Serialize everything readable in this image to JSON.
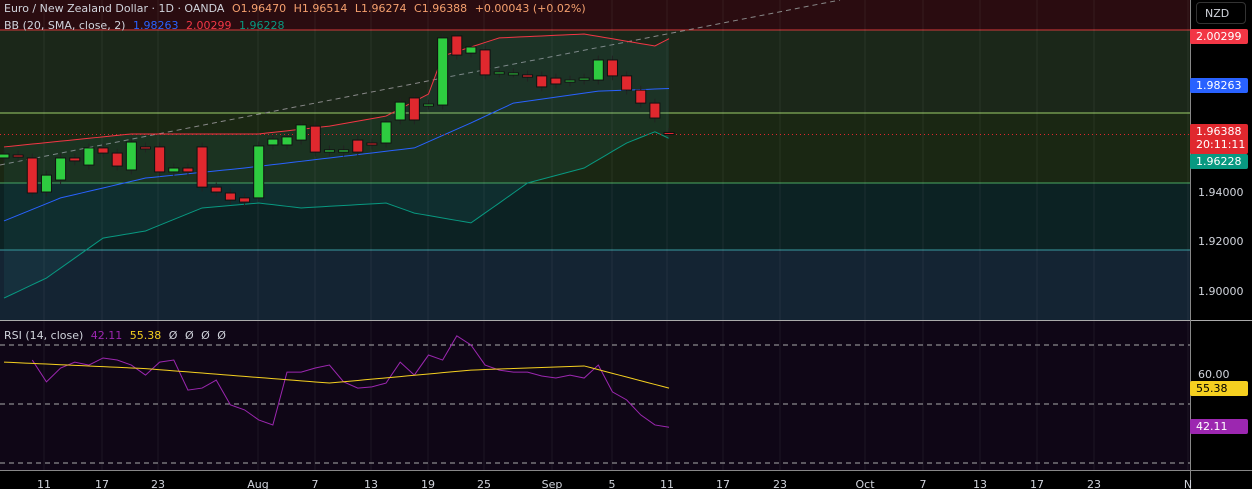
{
  "header": {
    "symbol": "Euro / New Zealand Dollar · 1D · OANDA",
    "open": "O1.96470",
    "high": "H1.96514",
    "low": "L1.96274",
    "close": "C1.96388",
    "change": "+0.00043 (+0.02%)"
  },
  "bb_legend": {
    "label": "BB (20, SMA, close, 2)",
    "basis": "1.98263",
    "upper": "2.00299",
    "lower": "1.96228"
  },
  "rsi_legend": {
    "label": "RSI (14, close)",
    "rsi": "42.11",
    "ma": "55.38",
    "extra": [
      "Ø",
      "Ø",
      "Ø",
      "Ø"
    ]
  },
  "price_axis": {
    "currency": "NZD",
    "ticks": [
      "1.94000",
      "1.92000",
      "1.90000"
    ],
    "upper_tag": "2.00299",
    "basis_tag": "1.98263",
    "last_tag": "1.96388",
    "countdown": "20:11:11",
    "lower_tag": "1.96228"
  },
  "rsi_axis": {
    "ticks": [
      "60.00"
    ],
    "ma_tag": "55.38",
    "rsi_tag": "42.11"
  },
  "time_axis": [
    "11",
    "17",
    "23",
    "Aug",
    "7",
    "13",
    "19",
    "25",
    "Sep",
    "5",
    "11",
    "17",
    "23",
    "Oct",
    "7",
    "13",
    "17",
    "23",
    "N"
  ],
  "colors": {
    "up": "#2ecc40",
    "down": "#e0282e",
    "bb_upper": "#f23645",
    "bb_basis": "#2962ff",
    "bb_lower": "#089981",
    "rsi": "#9c27b0",
    "rsi_ma": "#f5d020"
  },
  "chart_data": {
    "type": "candlestick",
    "candles": [
      [
        1.9543,
        1.9559
      ],
      [
        1.9555,
        1.9547
      ],
      [
        1.9543,
        1.94
      ],
      [
        1.9404,
        1.9473
      ],
      [
        1.9453,
        1.9543
      ],
      [
        1.9543,
        1.9531
      ],
      [
        1.9514,
        1.9584
      ],
      [
        1.9584,
        1.9563
      ],
      [
        1.9563,
        1.951
      ],
      [
        1.9494,
        1.9608
      ],
      [
        1.9588,
        1.9584
      ],
      [
        1.9588,
        1.9486
      ],
      [
        1.9486,
        1.9502
      ],
      [
        1.9502,
        1.9486
      ],
      [
        1.9588,
        1.9424
      ],
      [
        1.9424,
        1.9404
      ],
      [
        1.94,
        1.9371
      ],
      [
        1.938,
        1.9363
      ],
      [
        1.938,
        1.9592
      ],
      [
        1.9596,
        1.962
      ],
      [
        1.9596,
        1.9629
      ],
      [
        1.9616,
        1.9678
      ],
      [
        1.9673,
        1.9567
      ],
      [
        1.9567,
        1.9576
      ],
      [
        1.9567,
        1.9576
      ],
      [
        1.9616,
        1.9567
      ],
      [
        1.9604,
        1.9596
      ],
      [
        1.9604,
        1.969
      ],
      [
        1.9698,
        1.9771
      ],
      [
        1.9788,
        1.9698
      ],
      [
        1.9759,
        1.9763
      ],
      [
        1.9759,
        2.0033
      ],
      [
        2.0041,
        1.9963
      ],
      [
        1.9971,
        1.9996
      ],
      [
        1.9984,
        1.9882
      ],
      [
        1.989,
        1.9894
      ],
      [
        1.989,
        1.989
      ],
      [
        1.9882,
        1.9873
      ],
      [
        1.9878,
        1.9833
      ],
      [
        1.9869,
        1.9845
      ],
      [
        1.9853,
        1.9861
      ],
      [
        1.9861,
        1.9869
      ],
      [
        1.9861,
        1.9943
      ],
      [
        1.9943,
        1.9878
      ],
      [
        1.9878,
        1.982
      ],
      [
        1.982,
        1.9767
      ],
      [
        1.9767,
        1.9706
      ],
      [
        1.9647,
        1.96388
      ]
    ],
    "bb_upper": [
      [
        0,
        1.9588
      ],
      [
        9,
        1.9641
      ],
      [
        18,
        1.9641
      ],
      [
        23,
        1.9673
      ],
      [
        27,
        1.9714
      ],
      [
        30,
        1.9804
      ],
      [
        31,
        1.9959
      ],
      [
        35,
        2.0033
      ],
      [
        41,
        2.0049
      ],
      [
        46,
        2.0
      ],
      [
        47,
        2.00299
      ]
    ],
    "bb_basis": [
      [
        0,
        1.9286
      ],
      [
        4,
        1.938
      ],
      [
        10,
        1.9461
      ],
      [
        17,
        1.9502
      ],
      [
        23,
        1.9543
      ],
      [
        29,
        1.9584
      ],
      [
        33,
        1.9686
      ],
      [
        36,
        1.9767
      ],
      [
        42,
        1.9816
      ],
      [
        47,
        1.98263
      ]
    ],
    "bb_lower": [
      [
        0,
        1.8971
      ],
      [
        3,
        1.9053
      ],
      [
        7,
        1.9216
      ],
      [
        10,
        1.9245
      ],
      [
        14,
        1.9339
      ],
      [
        18,
        1.9359
      ],
      [
        21,
        1.9339
      ],
      [
        27,
        1.9359
      ],
      [
        29,
        1.9318
      ],
      [
        33,
        1.9278
      ],
      [
        35,
        1.9359
      ],
      [
        37,
        1.9441
      ],
      [
        41,
        1.9502
      ],
      [
        44,
        1.9604
      ],
      [
        46,
        1.965
      ],
      [
        47,
        1.96228
      ]
    ],
    "rsi": [
      64.9,
      57.5,
      62.2,
      64.2,
      63.2,
      65.6,
      64.9,
      63.2,
      59.8,
      64.2,
      64.9,
      54.7,
      55.4,
      58.1,
      49.7,
      48.0,
      44.6,
      42.9,
      60.8,
      60.8,
      62.2,
      63.2,
      57.5,
      55.4,
      55.8,
      57.1,
      64.2,
      59.8,
      66.6,
      64.9,
      73.1,
      70.0,
      63.2,
      61.5,
      60.8,
      60.8,
      59.5,
      58.8,
      59.8,
      58.8,
      63.2,
      54.1,
      51.4,
      46.3,
      42.9,
      42.11
    ],
    "rsi_ma": [
      [
        0,
        64.2
      ],
      [
        10,
        62
      ],
      [
        23,
        57.1
      ],
      [
        33,
        61.5
      ],
      [
        41,
        62.9
      ],
      [
        47,
        55.38
      ]
    ],
    "rsi_levels": [
      70,
      50,
      30
    ],
    "price_range": [
      1.88,
      2.02
    ]
  }
}
